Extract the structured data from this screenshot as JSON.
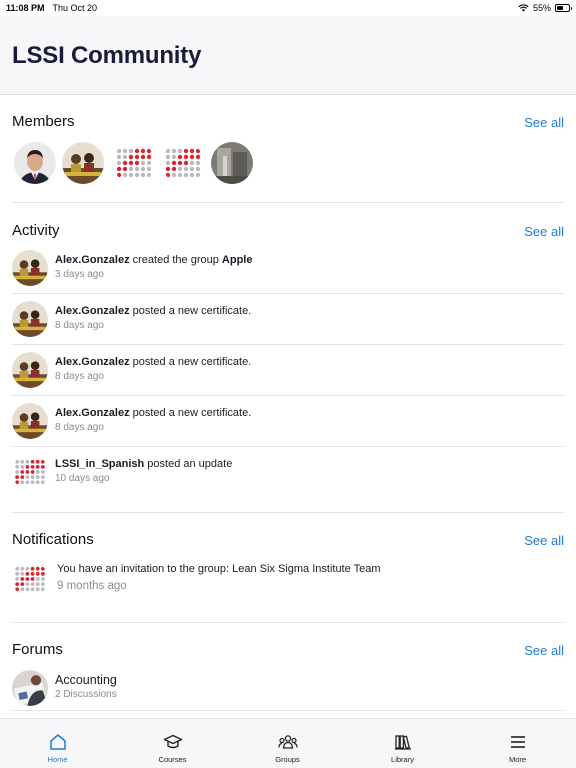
{
  "status_bar": {
    "time": "11:08 PM",
    "date": "Thu Oct 20",
    "battery": "55%",
    "battery_level": 0.55
  },
  "header": {
    "title": "LSSI Community"
  },
  "members": {
    "title": "Members",
    "see_all": "See all",
    "avatars": [
      "man-photo",
      "group-photo",
      "lssi-dots-logo",
      "lssi-dots-logo",
      "landscape-photo"
    ]
  },
  "activity": {
    "title": "Activity",
    "see_all": "See all",
    "items": [
      {
        "actor": "Alex.Gonzalez",
        "action": " created the group ",
        "target": "Apple",
        "time": "3 days ago"
      },
      {
        "actor": "Alex.Gonzalez",
        "action": " posted a new certificate.",
        "target": "",
        "time": "8 days ago"
      },
      {
        "actor": "Alex.Gonzalez",
        "action": " posted a new certificate.",
        "target": "",
        "time": "8 days ago"
      },
      {
        "actor": "Alex.Gonzalez",
        "action": " posted a new certificate.",
        "target": "",
        "time": "8 days ago"
      },
      {
        "actor": "LSSI_in_Spanish",
        "action": " posted an update",
        "target": "",
        "time": "10 days ago"
      }
    ]
  },
  "notifications": {
    "title": "Notifications",
    "see_all": "See all",
    "items": [
      {
        "text": "You have an invitation to the group: Lean Six Sigma Institute Team",
        "time": "9 months ago"
      }
    ]
  },
  "forums": {
    "title": "Forums",
    "see_all": "See all",
    "items": [
      {
        "name": "Accounting",
        "meta": "2 Discussions"
      }
    ]
  },
  "tab_bar": {
    "tabs": [
      {
        "label": "Home",
        "icon": "home-icon",
        "active": true
      },
      {
        "label": "Courses",
        "icon": "graduation-cap-icon",
        "active": false
      },
      {
        "label": "Groups",
        "icon": "groups-icon",
        "active": false
      },
      {
        "label": "Library",
        "icon": "library-icon",
        "active": false
      },
      {
        "label": "More",
        "icon": "menu-icon",
        "active": false
      }
    ]
  },
  "colors": {
    "accent": "#1a7ed6",
    "title": "#1b1b3a",
    "logo_red": "#d8262f",
    "logo_gray": "#b9b9be"
  }
}
